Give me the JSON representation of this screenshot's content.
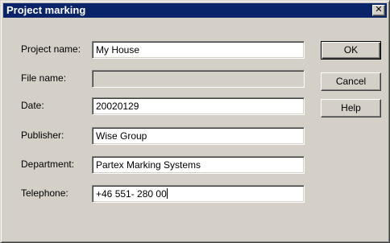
{
  "dialog": {
    "title": "Project marking",
    "close_glyph": "✕"
  },
  "fields": {
    "project_name": {
      "label": "Project name:",
      "value": "My House"
    },
    "file_name": {
      "label": "File name:",
      "value": "",
      "enabled": false
    },
    "date": {
      "label": "Date:",
      "value": "20020129"
    },
    "publisher": {
      "label": "Publisher:",
      "value": "Wise Group"
    },
    "department": {
      "label": "Department:",
      "value": "Partex Marking Systems"
    },
    "telephone": {
      "label": "Telephone:",
      "value": "+46 551- 280 00"
    }
  },
  "buttons": {
    "ok": "OK",
    "cancel": "Cancel",
    "help": "Help"
  },
  "colors": {
    "titlebar": "#0a246a",
    "face": "#d4d0c8"
  }
}
